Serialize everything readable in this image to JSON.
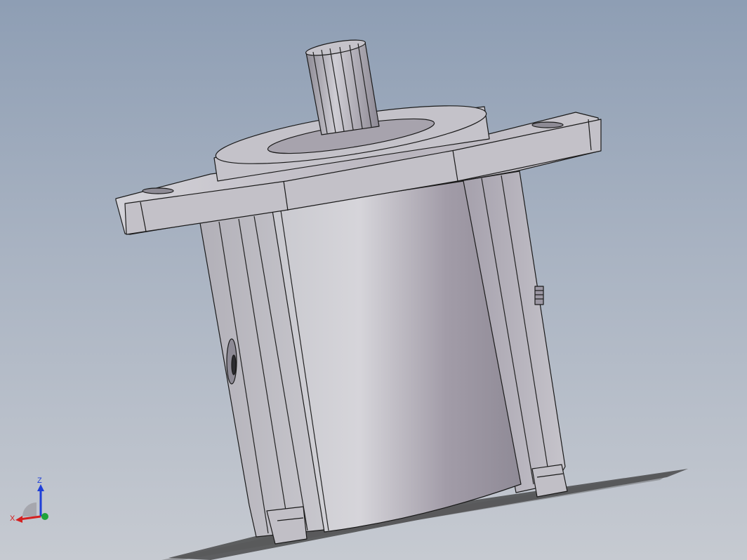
{
  "viewport": {
    "background_top": "#8e9eb4",
    "background_bottom": "#c6cad1"
  },
  "model": {
    "part": "hydraulic-gear-motor",
    "body_color": "#b9b6bf",
    "edge_color": "#1a1a1a"
  },
  "triad": {
    "z_label": "Z",
    "x_label": "X",
    "z_color": "#1f3fd8",
    "x_color": "#d42020",
    "y_color": "#1fa33a"
  }
}
